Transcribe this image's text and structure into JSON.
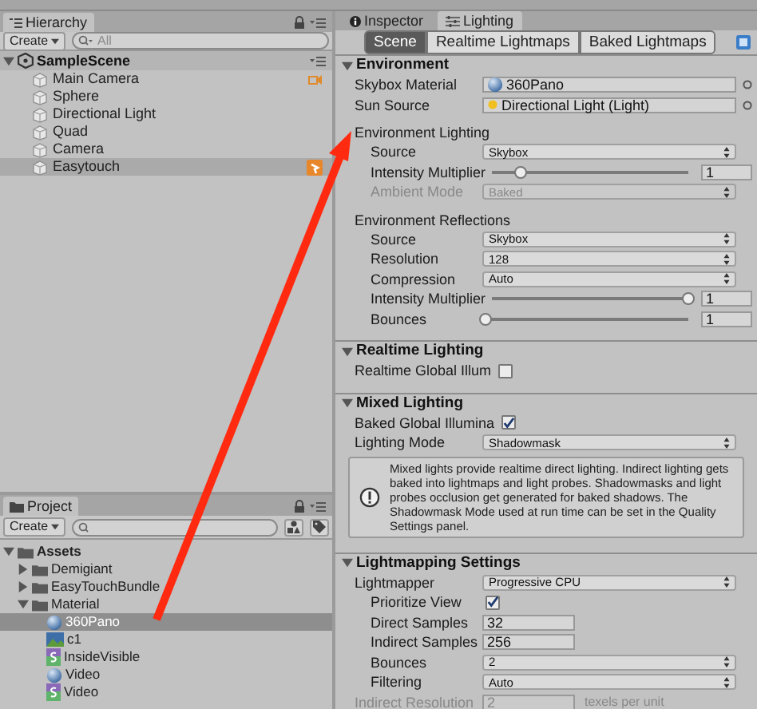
{
  "hierarchy": {
    "tab": "Hierarchy",
    "create": "Create",
    "search_placeholder": "All",
    "scene": {
      "name": "SampleScene",
      "expanded": true
    },
    "items": [
      {
        "name": "Main Camera",
        "selected": false,
        "kind": "gizmo"
      },
      {
        "name": "Sphere",
        "selected": false,
        "kind": "plain"
      },
      {
        "name": "Directional Light",
        "selected": false,
        "kind": "plain"
      },
      {
        "name": "Quad",
        "selected": false,
        "kind": "plain"
      },
      {
        "name": "Camera",
        "selected": false,
        "kind": "plain"
      },
      {
        "name": "Easytouch",
        "selected": true,
        "kind": "script"
      }
    ]
  },
  "project": {
    "tab": "Project",
    "create": "Create",
    "items": [
      {
        "name": "Assets",
        "kind": "folder",
        "expanded": true,
        "selected": false,
        "children": [
          {
            "name": "Demigiant",
            "kind": "folder",
            "expanded": false,
            "selected": false
          },
          {
            "name": "EasyTouchBundle",
            "kind": "folder",
            "expanded": false,
            "selected": false
          },
          {
            "name": "Material",
            "kind": "folder",
            "expanded": true,
            "selected": false,
            "children": [
              {
                "name": "360Pano",
                "kind": "material",
                "selected": true
              },
              {
                "name": "c1",
                "kind": "texture",
                "selected": false
              },
              {
                "name": "InsideVisible",
                "kind": "shader",
                "selected": false
              },
              {
                "name": "Video",
                "kind": "material",
                "selected": false
              },
              {
                "name": "Video",
                "kind": "shader",
                "selected": false
              }
            ]
          }
        ]
      }
    ]
  },
  "inspector": {
    "tabs": [
      {
        "label": "Inspector",
        "selected": false
      },
      {
        "label": "Lighting",
        "selected": true
      }
    ],
    "subtabs": [
      {
        "label": "Scene",
        "selected": true
      },
      {
        "label": "Realtime Lightmaps",
        "selected": false
      },
      {
        "label": "Baked Lightmaps",
        "selected": false
      }
    ],
    "sections": [
      {
        "title": "Environment",
        "expanded": true,
        "rows": [
          {
            "kind": "material",
            "label": "Skybox Material",
            "value": "360Pano",
            "disabled": false
          },
          {
            "kind": "light",
            "label": "Sun Source",
            "value": "Directional Light (Light)",
            "disabled": false
          },
          {
            "kind": "group",
            "label": "Environment Lighting",
            "children": [
              {
                "kind": "dropdown",
                "label": "Source",
                "value": "Skybox",
                "disabled": false
              },
              {
                "kind": "slider",
                "label": "Intensity Multiplier",
                "level": 0.15,
                "value": "1",
                "disabled": false
              },
              {
                "kind": "dropdown",
                "label": "Ambient Mode",
                "value": "Baked",
                "disabled": true
              }
            ]
          },
          {
            "kind": "group",
            "label": "Environment Reflections",
            "children": [
              {
                "kind": "dropdown",
                "label": "Source",
                "value": "Skybox",
                "disabled": false
              },
              {
                "kind": "dropdown",
                "label": "Resolution",
                "value": "128",
                "disabled": false
              },
              {
                "kind": "dropdown",
                "label": "Compression",
                "value": "Auto",
                "disabled": false
              },
              {
                "kind": "slider",
                "label": "Intensity Multiplier",
                "level": 1,
                "value": "1",
                "disabled": false
              },
              {
                "kind": "slider",
                "label": "Bounces",
                "level": 0,
                "value": "1",
                "disabled": false
              }
            ]
          }
        ]
      },
      {
        "title": "Realtime Lighting",
        "expanded": true,
        "rows": [
          {
            "kind": "checkbox",
            "label": "Realtime Global Illum",
            "checked": false,
            "disabled": false
          }
        ]
      },
      {
        "title": "Mixed Lighting",
        "expanded": true,
        "rows": [
          {
            "kind": "checkbox",
            "label": "Baked Global Illumina",
            "checked": true,
            "disabled": false
          },
          {
            "kind": "dropdown",
            "label": "Lighting Mode",
            "value": "Shadowmask",
            "disabled": false
          },
          {
            "kind": "info",
            "text": "Mixed lights provide realtime direct lighting. Indirect lighting gets baked into lightmaps and light probes. Shadowmasks and light probes occlusion get generated for baked shadows. The Shadowmask Mode used at run time can be set in the Quality Settings panel."
          }
        ]
      },
      {
        "title": "Lightmapping Settings",
        "expanded": true,
        "rows": [
          {
            "kind": "dropdown",
            "label": "Lightmapper",
            "value": "Progressive CPU",
            "disabled": false,
            "children": [
              {
                "kind": "checkbox",
                "label": "Prioritize View",
                "checked": true,
                "disabled": false
              },
              {
                "kind": "number",
                "label": "Direct Samples",
                "value": "32",
                "disabled": false
              },
              {
                "kind": "number",
                "label": "Indirect Samples",
                "value": "256",
                "disabled": false
              },
              {
                "kind": "dropdown",
                "label": "Bounces",
                "value": "2",
                "disabled": false
              },
              {
                "kind": "dropdown",
                "label": "Filtering",
                "value": "Auto",
                "disabled": false
              }
            ]
          },
          {
            "kind": "number",
            "label": "Indirect Resolution",
            "value": "2",
            "suffix": "texels per unit",
            "disabled": true
          }
        ]
      }
    ]
  }
}
